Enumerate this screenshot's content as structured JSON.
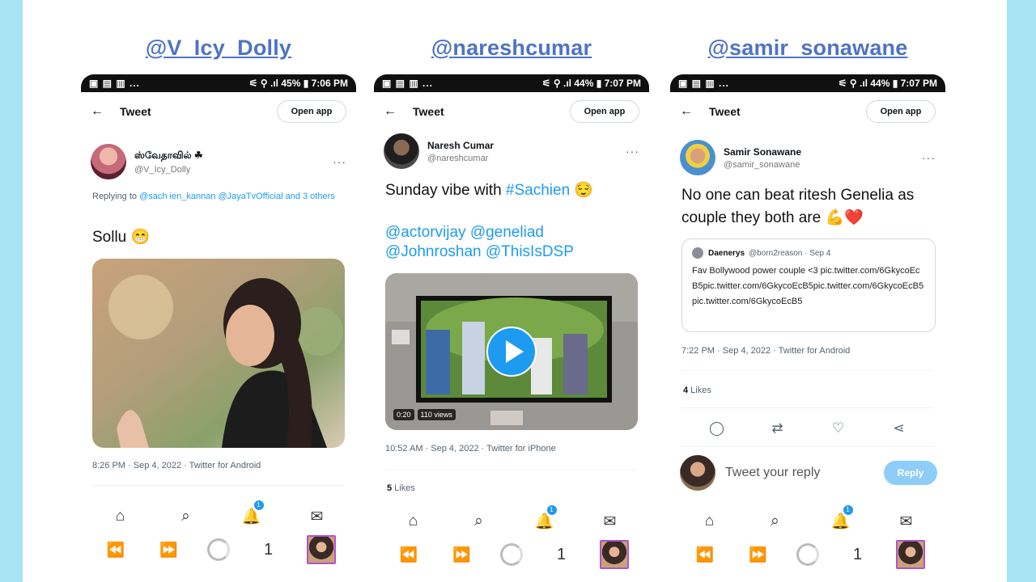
{
  "columns": [
    {
      "handle": "@V_Icy_Dolly",
      "status": {
        "left": "▣ ▤ ▥ ...",
        "right": "⚟ ⚲ .ıl 45% ▮ 7:06 PM"
      },
      "topbar": {
        "title": "Tweet",
        "open_app": "Open app"
      },
      "author": {
        "name": "ஸ்வேதாவில் ☘",
        "username": "@V_Icy_Dolly"
      },
      "replying": {
        "prefix": "Replying to ",
        "links": "@sach ien_kannan @JayaTvOfficial and 3 others"
      },
      "text": "Sollu 😁",
      "meta": "8:26 PM · Sep 4, 2022 · Twitter for Android",
      "nav_badge": "1",
      "sys_num": "1"
    },
    {
      "handle": "@nareshcumar",
      "status": {
        "left": "▣ ▤ ▥ ...",
        "right": "⚟ ⚲ .ıl 44% ▮ 7:07 PM"
      },
      "topbar": {
        "title": "Tweet",
        "open_app": "Open app"
      },
      "author": {
        "name": "Naresh Cumar",
        "username": "@nareshcumar"
      },
      "text_plain": "Sunday vibe with ",
      "text_hashtag": "#Sachien",
      "text_emoji": " 😌",
      "mentions_1": "@actorvijay @geneliad",
      "mentions_2": "@Johnroshan @ThisIsDSP",
      "video": {
        "duration": "0:20",
        "views": "110 views"
      },
      "meta": "10:52 AM · Sep 4, 2022 · Twitter for iPhone",
      "likes_count": "5",
      "likes_label": " Likes",
      "nav_badge": "1",
      "sys_num": "1"
    },
    {
      "handle": "@samir_sonawane",
      "status": {
        "left": "▣ ▤ ▥ ...",
        "right": "⚟ ⚲ .ıl 44% ▮ 7:07 PM"
      },
      "topbar": {
        "title": "Tweet",
        "open_app": "Open app"
      },
      "author": {
        "name": "Samir Sonawane",
        "username": "@samir_sonawane"
      },
      "text": "No one can beat ritesh Genelia as couple they both are 💪❤️",
      "quote": {
        "name": "Daenerys",
        "username": "@born2reason",
        "date": "· Sep 4",
        "text": "Fav Bollywood power couple <3 pic.twitter.com/6GkycoEcB5pic.twitter.com/6GkycoEcB5pic.twitter.com/6GkycoEcB5pic.twitter.com/6GkycoEcB5"
      },
      "meta": "7:22 PM · Sep 4, 2022 · Twitter for Android",
      "likes_count": "4",
      "likes_label": " Likes",
      "reply_placeholder": "Tweet your reply",
      "reply_button": "Reply",
      "nav_badge": "1",
      "sys_num": "1"
    }
  ],
  "icons": {
    "back": "←",
    "more": "···",
    "home": "⌂",
    "search": "⌕",
    "bell": "🔔",
    "mail": "✉",
    "rewind": "⏪",
    "forward": "⏩",
    "reply": "◯",
    "retweet": "⇄",
    "like": "♡",
    "share": "⋖"
  },
  "colors": {
    "accent": "#1d9bf0",
    "handle": "#4f73c4",
    "side": "#a8e4f3"
  }
}
